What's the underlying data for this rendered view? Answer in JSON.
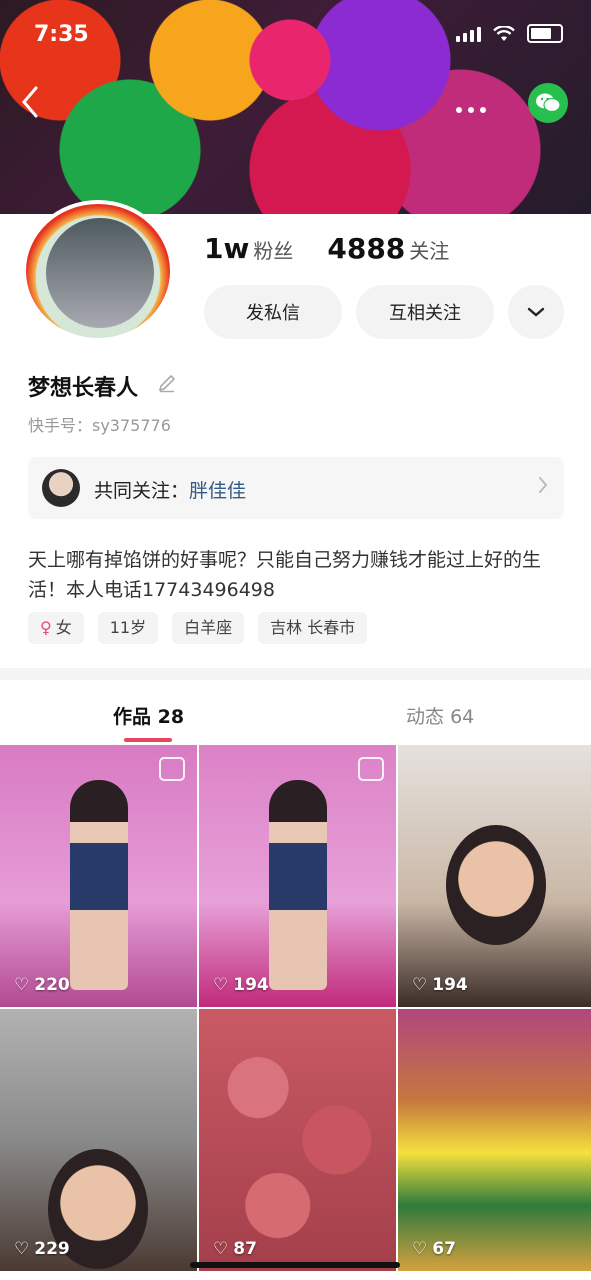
{
  "status": {
    "time": "7:35"
  },
  "profile": {
    "fans_count": "1w",
    "fans_label": "粉丝",
    "following_count": "4888",
    "following_label": "关注",
    "message_button": "发私信",
    "follow_button": "互相关注",
    "name": "梦想长春人",
    "kuaishou_id": "快手号：sy375776",
    "mutual_label": "共同关注：",
    "mutual_name": "胖佳佳",
    "bio": "天上哪有掉馅饼的好事呢？只能自己努力赚钱才能过上好的生活！本人电话17743496498",
    "tags": [
      "女",
      "11岁",
      "白羊座",
      "吉林 长春市"
    ]
  },
  "tabs": [
    {
      "label": "作品",
      "count": "28"
    },
    {
      "label": "动态",
      "count": "64"
    }
  ],
  "videos": [
    {
      "likes": "220"
    },
    {
      "likes": "194"
    },
    {
      "likes": "194"
    },
    {
      "likes": "229"
    },
    {
      "likes": "87"
    },
    {
      "likes": "67"
    }
  ],
  "colors": {
    "accent": "#e8455f",
    "link": "#355a84",
    "wechat": "#27c04e"
  },
  "icons": [
    "back-icon",
    "more-icon",
    "wechat-icon",
    "chevron-down-icon",
    "edit-icon",
    "chevron-right-icon",
    "female-icon",
    "heart-icon",
    "pin-icon"
  ]
}
